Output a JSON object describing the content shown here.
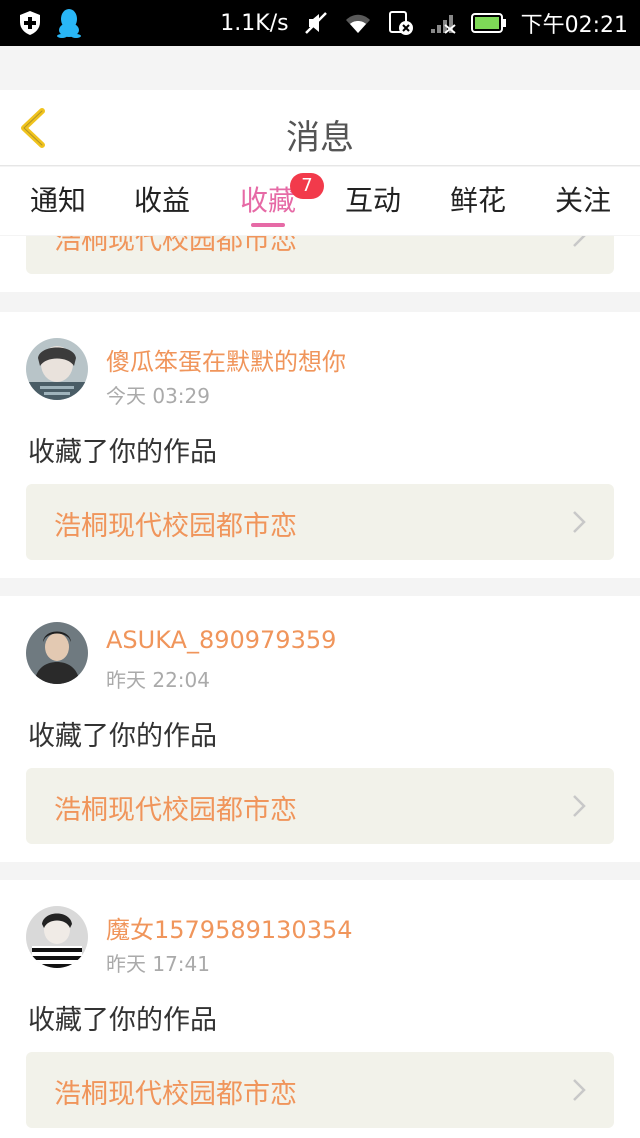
{
  "status_bar": {
    "speed": "1.1K/s",
    "time": "下午02:21"
  },
  "header": {
    "title": "消息"
  },
  "tabs": [
    {
      "label": "通知"
    },
    {
      "label": "收益"
    },
    {
      "label": "收藏",
      "badge": "7"
    },
    {
      "label": "互动"
    },
    {
      "label": "鲜花"
    },
    {
      "label": "关注"
    }
  ],
  "colors": {
    "accent": "#e66aa6",
    "badge": "#f23a4b",
    "username": "#f0955b",
    "work_title": "#f0955b"
  },
  "partial_item": {
    "work_title": "浩桐现代校园都市恋"
  },
  "items": [
    {
      "username": "傻瓜笨蛋在默默的想你",
      "time": "今天 03:29",
      "action": "收藏了你的作品",
      "work_title": "浩桐现代校园都市恋"
    },
    {
      "username": "ASUKA_890979359",
      "time": "昨天 22:04",
      "action": "收藏了你的作品",
      "work_title": "浩桐现代校园都市恋"
    },
    {
      "username": "魔女1579589130354",
      "time": "昨天 17:41",
      "action": "收藏了你的作品",
      "work_title": "浩桐现代校园都市恋"
    }
  ]
}
